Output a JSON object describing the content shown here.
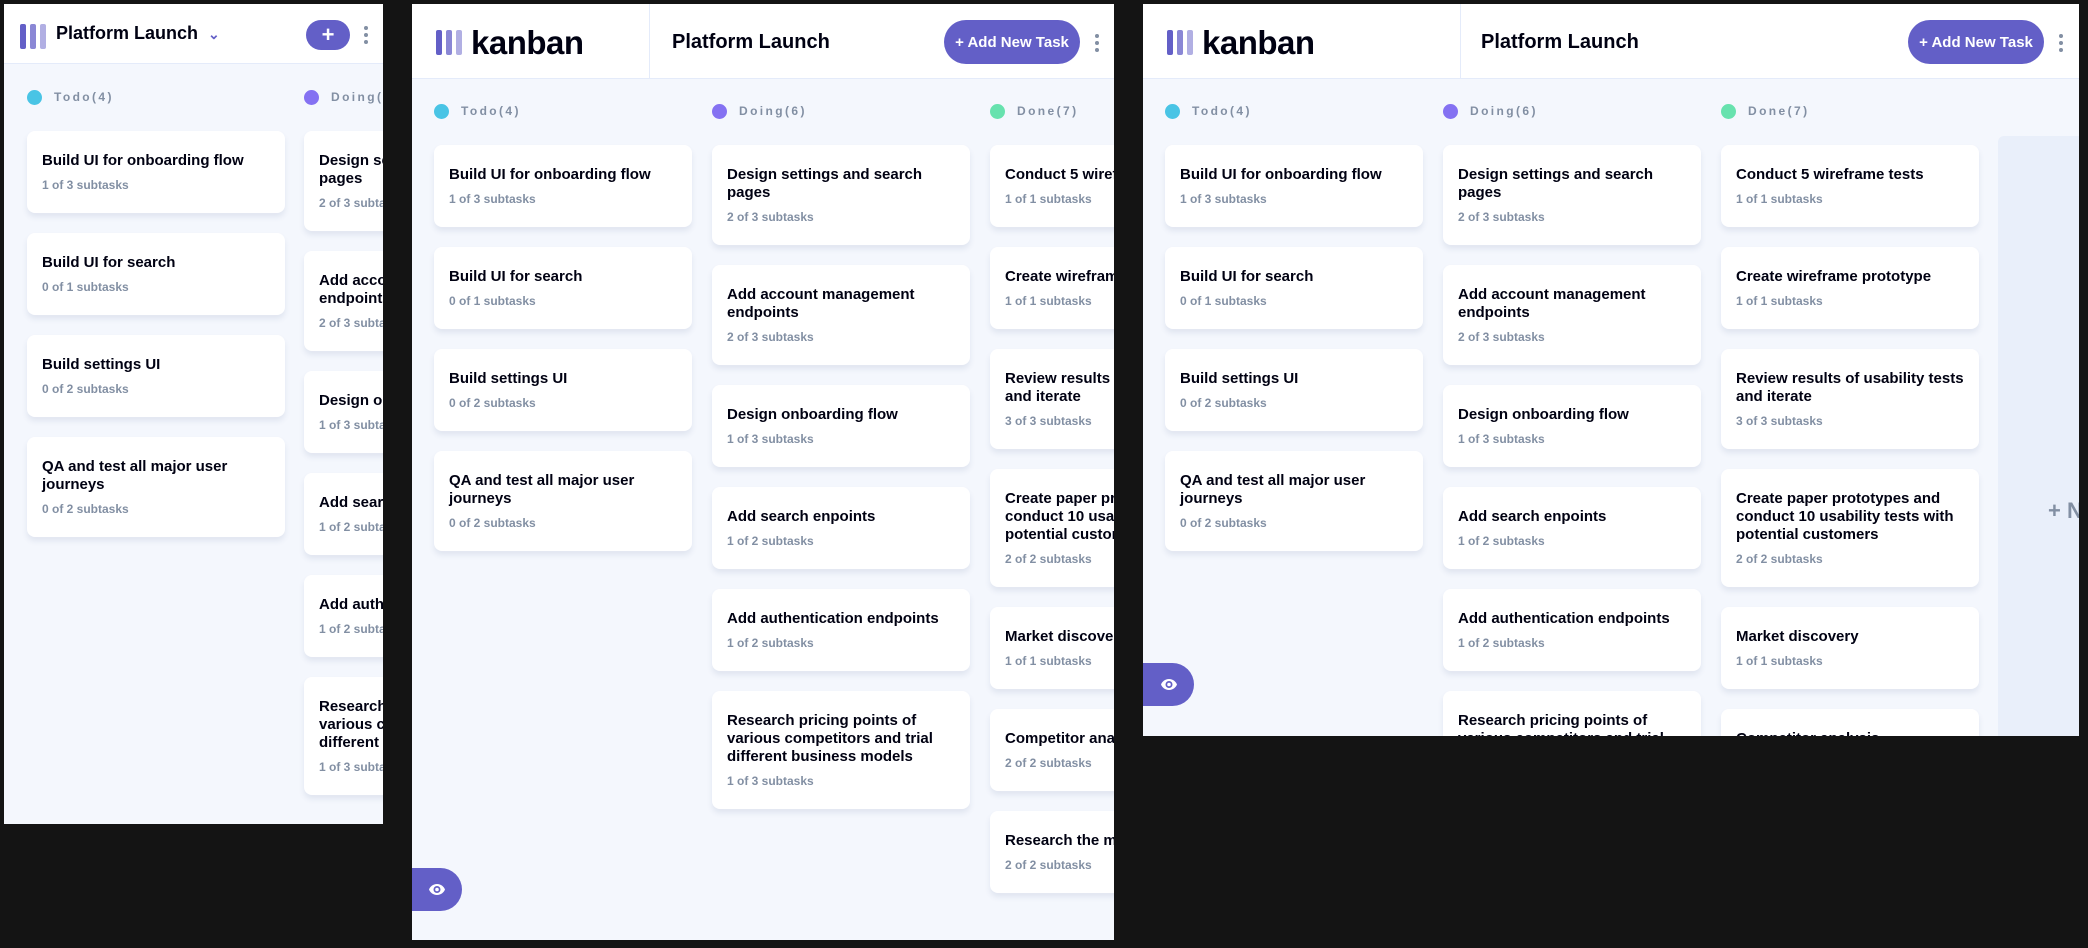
{
  "app": {
    "logo_text": "kanban",
    "board_name": "Platform Launch",
    "add_task_label": "+ Add New Task",
    "mobile_add_label": "+",
    "new_column_label": "+ New Column"
  },
  "icons": {
    "board": "kanban-logo-icon",
    "chevron": "chevron-down-icon",
    "menu": "vertical-ellipsis-icon",
    "show_sidebar": "eye-icon"
  },
  "colors": {
    "accent": "#635FC7",
    "todo": "#49C4E5",
    "doing": "#8471F2",
    "done": "#67E2AE"
  },
  "columns": [
    {
      "label": "Todo(4)",
      "tasks": [
        {
          "title": "Build UI for onboarding flow",
          "sub": "1 of 3 subtasks"
        },
        {
          "title": "Build UI for search",
          "sub": "0 of 1 subtasks"
        },
        {
          "title": "Build settings UI",
          "sub": "0 of 2 subtasks"
        },
        {
          "title": "QA and test all major user journeys",
          "sub": "0 of 2 subtasks"
        }
      ]
    },
    {
      "label": "Doing(6)",
      "tasks": [
        {
          "title": "Design settings and search pages",
          "sub": "2 of 3 subtasks"
        },
        {
          "title": "Add account management endpoints",
          "sub": "2 of 3 subtasks"
        },
        {
          "title": "Design onboarding flow",
          "sub": "1 of 3 subtasks"
        },
        {
          "title": "Add search enpoints",
          "sub": "1 of 2 subtasks"
        },
        {
          "title": "Add authentication endpoints",
          "sub": "1 of 2 subtasks"
        },
        {
          "title": "Research pricing points of various competitors and trial different business models",
          "sub": "1 of 3 subtasks"
        }
      ]
    },
    {
      "label": "Done(7)",
      "tasks": [
        {
          "title": "Conduct 5 wireframe tests",
          "sub": "1 of 1 subtasks"
        },
        {
          "title": "Create wireframe prototype",
          "sub": "1 of 1 subtasks"
        },
        {
          "title": "Review results of usability tests and iterate",
          "sub": "3 of 3 subtasks"
        },
        {
          "title": "Create paper prototypes and conduct 10 usability tests with potential customers",
          "sub": "2 of 2 subtasks"
        },
        {
          "title": "Market discovery",
          "sub": "1 of 1 subtasks"
        },
        {
          "title": "Competitor analysis",
          "sub": "2 of 2 subtasks"
        },
        {
          "title": "Research the market",
          "sub": "2 of 2 subtasks"
        }
      ]
    }
  ]
}
